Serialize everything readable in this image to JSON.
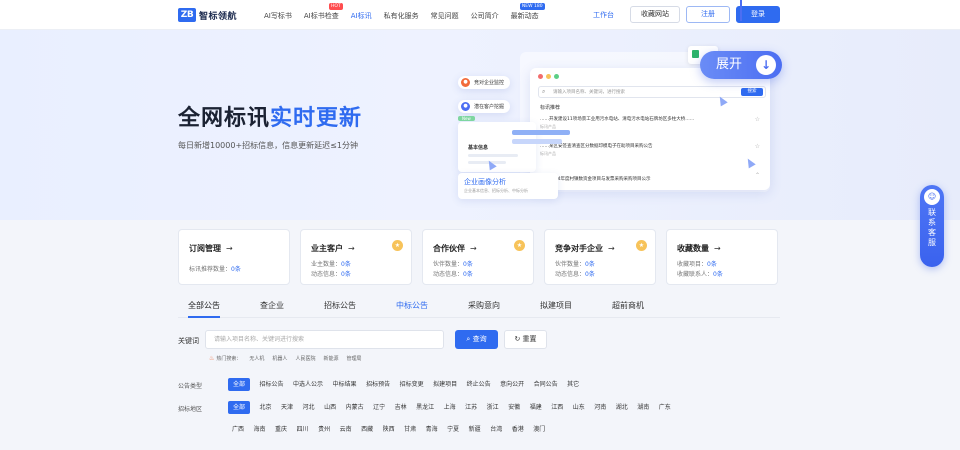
{
  "header": {
    "logo_mark": "ZB",
    "logo_text": "智标领航",
    "nav": [
      {
        "label": "AI写标书",
        "badge": ""
      },
      {
        "label": "AI标书检查",
        "badge": "HOT"
      },
      {
        "label": "AI标讯",
        "badge": ""
      },
      {
        "label": "私有化服务",
        "badge": ""
      },
      {
        "label": "常见问题",
        "badge": ""
      },
      {
        "label": "公司简介",
        "badge": ""
      },
      {
        "label": "最新动态",
        "badge": "NEW 180"
      }
    ],
    "workbench": "工作台",
    "bookmark": "收藏网站",
    "register": "注册",
    "login": "登录"
  },
  "hero": {
    "title_a": "全网标讯",
    "title_b": "实时更新",
    "subtitle": "每日新增10000+招标信息，信息更新延迟≤1分钟",
    "expand": "展开",
    "chip1": "竞对企业监控",
    "chip2": "潜在客户挖掘",
    "mock_search_placeholder": "请输入项目名称、关键词，进行搜索",
    "mock_search_button": "搜索",
    "mock_label": "标讯推荐",
    "mock_rows": [
      {
        "title": "……开发建设11项场景工业用污水电站、清电污水电站石牌坊区多柱大桥……",
        "meta": "标讯产品"
      },
      {
        "title": "……某区安签查清查区分数据印模电子在助项目采购公告",
        "meta": "标讯产品"
      },
      {
        "title": "……2024年度村镇数资金项目与发票采购采购项目公示",
        "meta": ""
      }
    ],
    "side_tag": "New",
    "side_title": "基本信息",
    "analysis_title": "企业画像分析",
    "analysis_sub": "企业基本信息、招标分析、中标分析"
  },
  "service": {
    "label": "联系客服"
  },
  "cards": [
    {
      "title": "订阅管理",
      "lines": [
        {
          "k": "标讯推荐数量：",
          "v": "0条"
        }
      ],
      "coin": false
    },
    {
      "title": "业主客户",
      "lines": [
        {
          "k": "业主数量：",
          "v": "0条"
        },
        {
          "k": "动态信息：",
          "v": "0条"
        }
      ],
      "coin": true
    },
    {
      "title": "合作伙伴",
      "lines": [
        {
          "k": "伙伴数量：",
          "v": "0条"
        },
        {
          "k": "动态信息：",
          "v": "0条"
        }
      ],
      "coin": true
    },
    {
      "title": "竞争对手企业",
      "lines": [
        {
          "k": "伙伴数量：",
          "v": "0条"
        },
        {
          "k": "动态信息：",
          "v": "0条"
        }
      ],
      "coin": true
    },
    {
      "title": "收藏数量",
      "lines": [
        {
          "k": "收藏项目：",
          "v": "0条"
        },
        {
          "k": "收藏联系人：",
          "v": "0条"
        }
      ],
      "coin": false
    }
  ],
  "tabs": [
    "全部公告",
    "查企业",
    "招标公告",
    "中标公告",
    "采购意向",
    "拟建项目",
    "超前商机"
  ],
  "search": {
    "label": "关键词",
    "placeholder": "请输入项目名称、关键词进行搜索",
    "query": "查询",
    "reset": "重置",
    "hot_label": "热门搜索：",
    "hot_words": [
      "无人机",
      "机器人",
      "人民医院",
      "新能源",
      "管理局"
    ]
  },
  "filters": {
    "type_label": "公告类型",
    "types": [
      "全部",
      "招标公告",
      "中选人公示",
      "中标结果",
      "招标预告",
      "招标变更",
      "拟建项目",
      "终止公告",
      "意向公开",
      "合同公告",
      "其它"
    ],
    "region_label": "招标地区",
    "regions_1": [
      "全部",
      "北京",
      "天津",
      "河北",
      "山西",
      "内蒙古",
      "辽宁",
      "吉林",
      "黑龙江",
      "上海",
      "江苏",
      "浙江",
      "安徽",
      "福建",
      "江西",
      "山东",
      "河南",
      "湖北",
      "湖南",
      "广东"
    ],
    "regions_2": [
      "广西",
      "海南",
      "重庆",
      "四川",
      "贵州",
      "云南",
      "西藏",
      "陕西",
      "甘肃",
      "青海",
      "宁夏",
      "新疆",
      "台湾",
      "香港",
      "澳门"
    ]
  },
  "colors": {
    "accent": "#2f6bf0",
    "coin": "#f7c35a"
  }
}
